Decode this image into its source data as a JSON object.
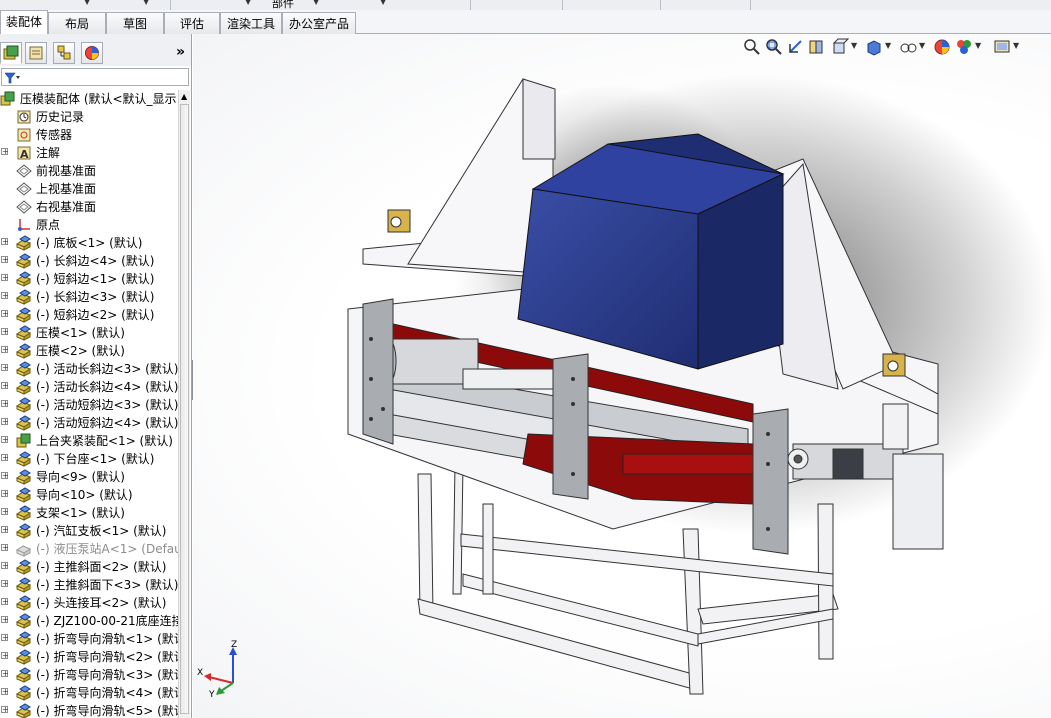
{
  "top_strip": {
    "label": "部件"
  },
  "tabs": [
    {
      "label": "装配体",
      "active": true
    },
    {
      "label": "布局"
    },
    {
      "label": "草图"
    },
    {
      "label": "评估"
    },
    {
      "label": "渲染工具"
    },
    {
      "label": "办公室产品"
    }
  ],
  "panel": {
    "tabs": [
      "featuremanager-icon",
      "propertymanager-icon",
      "configuration-manager-icon",
      "display-manager-icon"
    ],
    "expand_symbol": "»",
    "filter_icon": "filter-icon"
  },
  "tree": {
    "items": [
      {
        "label": "压模装配体 (默认<默认_显示",
        "icon": "assembly-icon",
        "indent": 0,
        "expander": ""
      },
      {
        "label": "历史记录",
        "icon": "history-icon",
        "indent": 1,
        "expander": ""
      },
      {
        "label": "传感器",
        "icon": "sensor-icon",
        "indent": 1,
        "expander": ""
      },
      {
        "label": "注解",
        "icon": "annotation-icon",
        "indent": 1,
        "expander": "+"
      },
      {
        "label": "前视基准面",
        "icon": "plane-icon",
        "indent": 1,
        "expander": ""
      },
      {
        "label": "上视基准面",
        "icon": "plane-icon",
        "indent": 1,
        "expander": ""
      },
      {
        "label": "右视基准面",
        "icon": "plane-icon",
        "indent": 1,
        "expander": ""
      },
      {
        "label": "原点",
        "icon": "origin-icon",
        "indent": 1,
        "expander": ""
      },
      {
        "label": "(-) 底板<1> (默认)",
        "icon": "part-icon",
        "indent": 1,
        "expander": "+"
      },
      {
        "label": "(-) 长斜边<4> (默认)",
        "icon": "part-icon",
        "indent": 1,
        "expander": "+"
      },
      {
        "label": "(-) 短斜边<1> (默认)",
        "icon": "part-icon",
        "indent": 1,
        "expander": "+"
      },
      {
        "label": "(-) 长斜边<3> (默认)",
        "icon": "part-icon",
        "indent": 1,
        "expander": "+"
      },
      {
        "label": "(-) 短斜边<2> (默认)",
        "icon": "part-icon",
        "indent": 1,
        "expander": "+"
      },
      {
        "label": "压模<1> (默认)",
        "icon": "part-icon",
        "indent": 1,
        "expander": "+"
      },
      {
        "label": "压模<2> (默认)",
        "icon": "part-icon",
        "indent": 1,
        "expander": "+"
      },
      {
        "label": "(-) 活动长斜边<3> (默认)",
        "icon": "part-icon",
        "indent": 1,
        "expander": "+"
      },
      {
        "label": "(-) 活动长斜边<4> (默认)",
        "icon": "part-icon",
        "indent": 1,
        "expander": "+"
      },
      {
        "label": "(-) 活动短斜边<3> (默认)",
        "icon": "part-icon",
        "indent": 1,
        "expander": "+"
      },
      {
        "label": "(-) 活动短斜边<4> (默认)",
        "icon": "part-icon",
        "indent": 1,
        "expander": "+"
      },
      {
        "label": "上台夹紧装配<1> (默认)",
        "icon": "subassembly-icon",
        "indent": 1,
        "expander": "+"
      },
      {
        "label": "(-) 下台座<1> (默认)",
        "icon": "part-icon",
        "indent": 1,
        "expander": "+"
      },
      {
        "label": "导向<9> (默认)",
        "icon": "part-icon",
        "indent": 1,
        "expander": "+"
      },
      {
        "label": "导向<10> (默认)",
        "icon": "part-icon",
        "indent": 1,
        "expander": "+"
      },
      {
        "label": "支架<1> (默认)",
        "icon": "part-icon",
        "indent": 1,
        "expander": "+"
      },
      {
        "label": "(-) 汽缸支板<1> (默认)",
        "icon": "part-icon",
        "indent": 1,
        "expander": "+"
      },
      {
        "label": "(-) 液压泵站A<1> (Defau",
        "icon": "suppressed-part-icon",
        "indent": 1,
        "expander": "+",
        "grey": true
      },
      {
        "label": "(-) 主推斜面<2> (默认)",
        "icon": "part-icon",
        "indent": 1,
        "expander": "+"
      },
      {
        "label": "(-) 主推斜面下<3> (默认)",
        "icon": "part-icon",
        "indent": 1,
        "expander": "+"
      },
      {
        "label": "(-) 头连接耳<2> (默认)",
        "icon": "part-icon",
        "indent": 1,
        "expander": "+"
      },
      {
        "label": "(-) ZJZ100-00-21底座连接",
        "icon": "part-icon",
        "indent": 1,
        "expander": "+"
      },
      {
        "label": "(-) 折弯导向滑轨<1> (默认",
        "icon": "part-icon",
        "indent": 1,
        "expander": "+"
      },
      {
        "label": "(-) 折弯导向滑轨<2> (默认",
        "icon": "part-icon",
        "indent": 1,
        "expander": "+"
      },
      {
        "label": "(-) 折弯导向滑轨<3> (默认",
        "icon": "part-icon",
        "indent": 1,
        "expander": "+"
      },
      {
        "label": "(-) 折弯导向滑轨<4> (默认",
        "icon": "part-icon",
        "indent": 1,
        "expander": "+"
      },
      {
        "label": "(-) 折弯导向滑轨<5> (默认",
        "icon": "part-icon",
        "indent": 1,
        "expander": "+"
      }
    ]
  },
  "heads_up_toolbar": [
    "zoom-to-fit-icon",
    "zoom-to-area-icon",
    "previous-view-icon",
    "section-view-icon",
    "view-orientation-icon",
    "display-style-icon",
    "hide-show-items-icon",
    "edit-appearance-icon",
    "apply-scene-icon",
    "view-settings-icon"
  ],
  "triad": {
    "x": "X",
    "y": "Y",
    "z": "Z"
  },
  "colors": {
    "box_blue": "#2b3c8c",
    "die_red": "#8c0a0a",
    "frame_white": "#f4f4f6",
    "plate_grey": "#a9acb0",
    "accent_yellow": "#d8b24a"
  }
}
